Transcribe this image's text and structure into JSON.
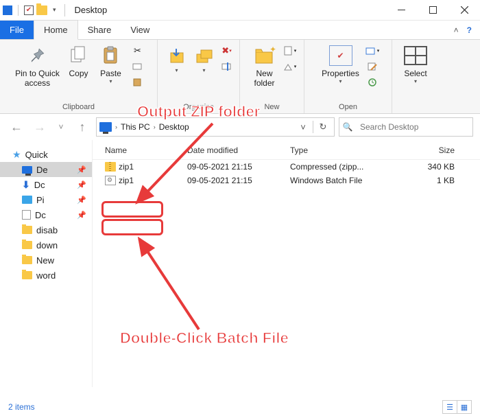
{
  "window": {
    "title": "Desktop"
  },
  "tabs": {
    "file": "File",
    "home": "Home",
    "share": "Share",
    "view": "View"
  },
  "ribbon": {
    "pin": "Pin to Quick\naccess",
    "copy": "Copy",
    "paste": "Paste",
    "group_clipboard": "Clipboard",
    "group_organize": "Organize",
    "newfolder": "New\nfolder",
    "group_new": "New",
    "properties": "Properties",
    "group_open": "Open",
    "select": "Select"
  },
  "breadcrumb": {
    "this_pc": "This PC",
    "desktop": "Desktop"
  },
  "search": {
    "placeholder": "Search Desktop"
  },
  "columns": {
    "name": "Name",
    "date": "Date modified",
    "type": "Type",
    "size": "Size"
  },
  "files": [
    {
      "name": "zip1",
      "date": "09-05-2021 21:15",
      "type": "Compressed (zipp...",
      "size": "340 KB",
      "kind": "zip"
    },
    {
      "name": "zip1",
      "date": "09-05-2021 21:15",
      "type": "Windows Batch File",
      "size": "1 KB",
      "kind": "bat"
    }
  ],
  "sidebar": {
    "quick": "Quick",
    "items": [
      {
        "label": "De",
        "icon": "monitor",
        "pinned": true
      },
      {
        "label": "Dc",
        "icon": "download",
        "pinned": true
      },
      {
        "label": "Pi",
        "icon": "picture",
        "pinned": true
      },
      {
        "label": "Dc",
        "icon": "document",
        "pinned": true
      },
      {
        "label": "disab",
        "icon": "folder"
      },
      {
        "label": "down",
        "icon": "folder"
      },
      {
        "label": "New",
        "icon": "folder"
      },
      {
        "label": "word",
        "icon": "folder"
      }
    ]
  },
  "status": {
    "text": "2 items"
  },
  "annotations": {
    "output": "Output ZIP folder",
    "batch": "Double-Click Batch File"
  }
}
